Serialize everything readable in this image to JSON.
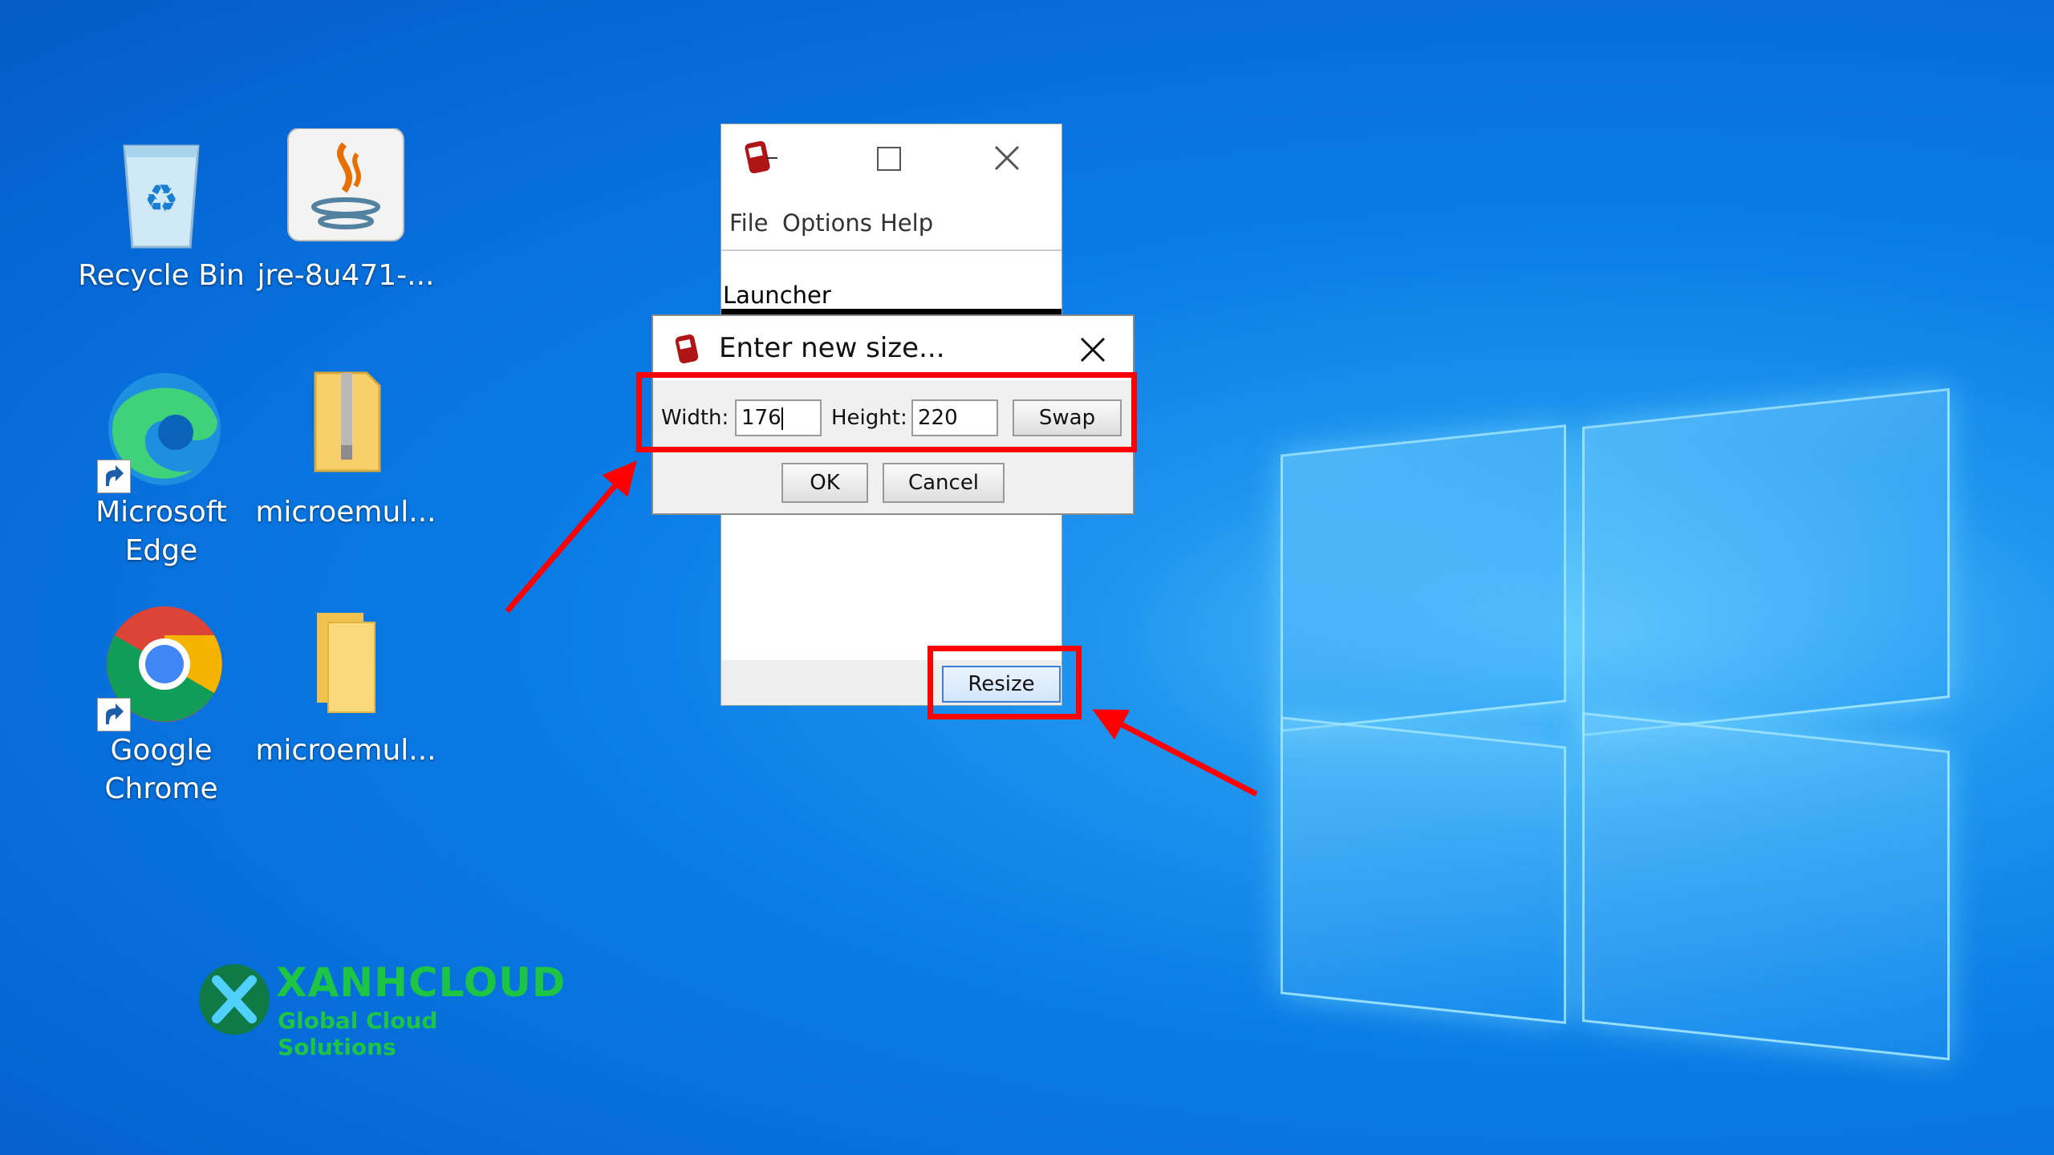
{
  "desktop": {
    "icons": [
      {
        "label": "Recycle Bin"
      },
      {
        "label": "jre-8u471-..."
      },
      {
        "label": "Microsoft Edge"
      },
      {
        "label": "microemul..."
      },
      {
        "label": "Google Chrome"
      },
      {
        "label": "microemul..."
      }
    ]
  },
  "app_window": {
    "menu": [
      "File",
      "Options",
      "Help"
    ],
    "content_label": "Launcher",
    "resize_button": "Resize"
  },
  "dialog": {
    "title": "Enter new size...",
    "width_label": "Width:",
    "width_value": "176",
    "height_label": "Height:",
    "height_value": "220",
    "swap_button": "Swap",
    "ok_button": "OK",
    "cancel_button": "Cancel"
  },
  "watermark": {
    "brand": "XANHCLOUD",
    "tagline": "Global Cloud Solutions"
  },
  "colors": {
    "highlight": "#ff0000",
    "desktop_blue": "#0b7de6",
    "brand_green": "#1ec545"
  }
}
